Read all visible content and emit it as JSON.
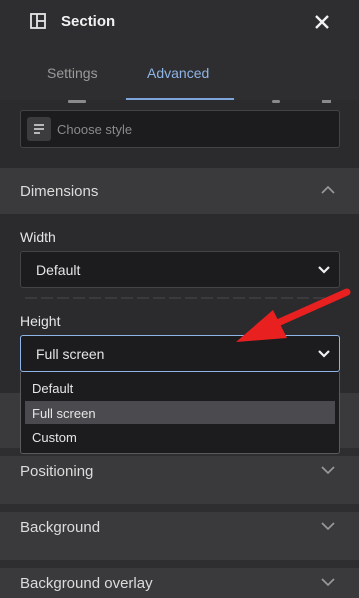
{
  "header": {
    "title": "Section"
  },
  "tabs": [
    {
      "label": "Settings",
      "active": false
    },
    {
      "label": "Advanced",
      "active": true
    }
  ],
  "style_field": {
    "placeholder": "Choose style"
  },
  "dimensions": {
    "title": "Dimensions",
    "width": {
      "label": "Width",
      "value": "Default"
    },
    "height": {
      "label": "Height",
      "value": "Full screen"
    },
    "height_options": [
      "Default",
      "Full screen",
      "Custom"
    ],
    "height_selected": "Full screen"
  },
  "sections": [
    {
      "label": "Positioning"
    },
    {
      "label": "Background"
    },
    {
      "label": "Background overlay"
    }
  ],
  "colors": {
    "accent": "#8fb4e6",
    "arrow": "#e82020",
    "panel": "#3a3a3c",
    "input_bg": "#1c1c1e"
  },
  "icons": [
    "section-layout-icon",
    "close-icon",
    "lines-icon",
    "chevron-up-icon",
    "chevron-down-icon",
    "annotation-arrow"
  ]
}
